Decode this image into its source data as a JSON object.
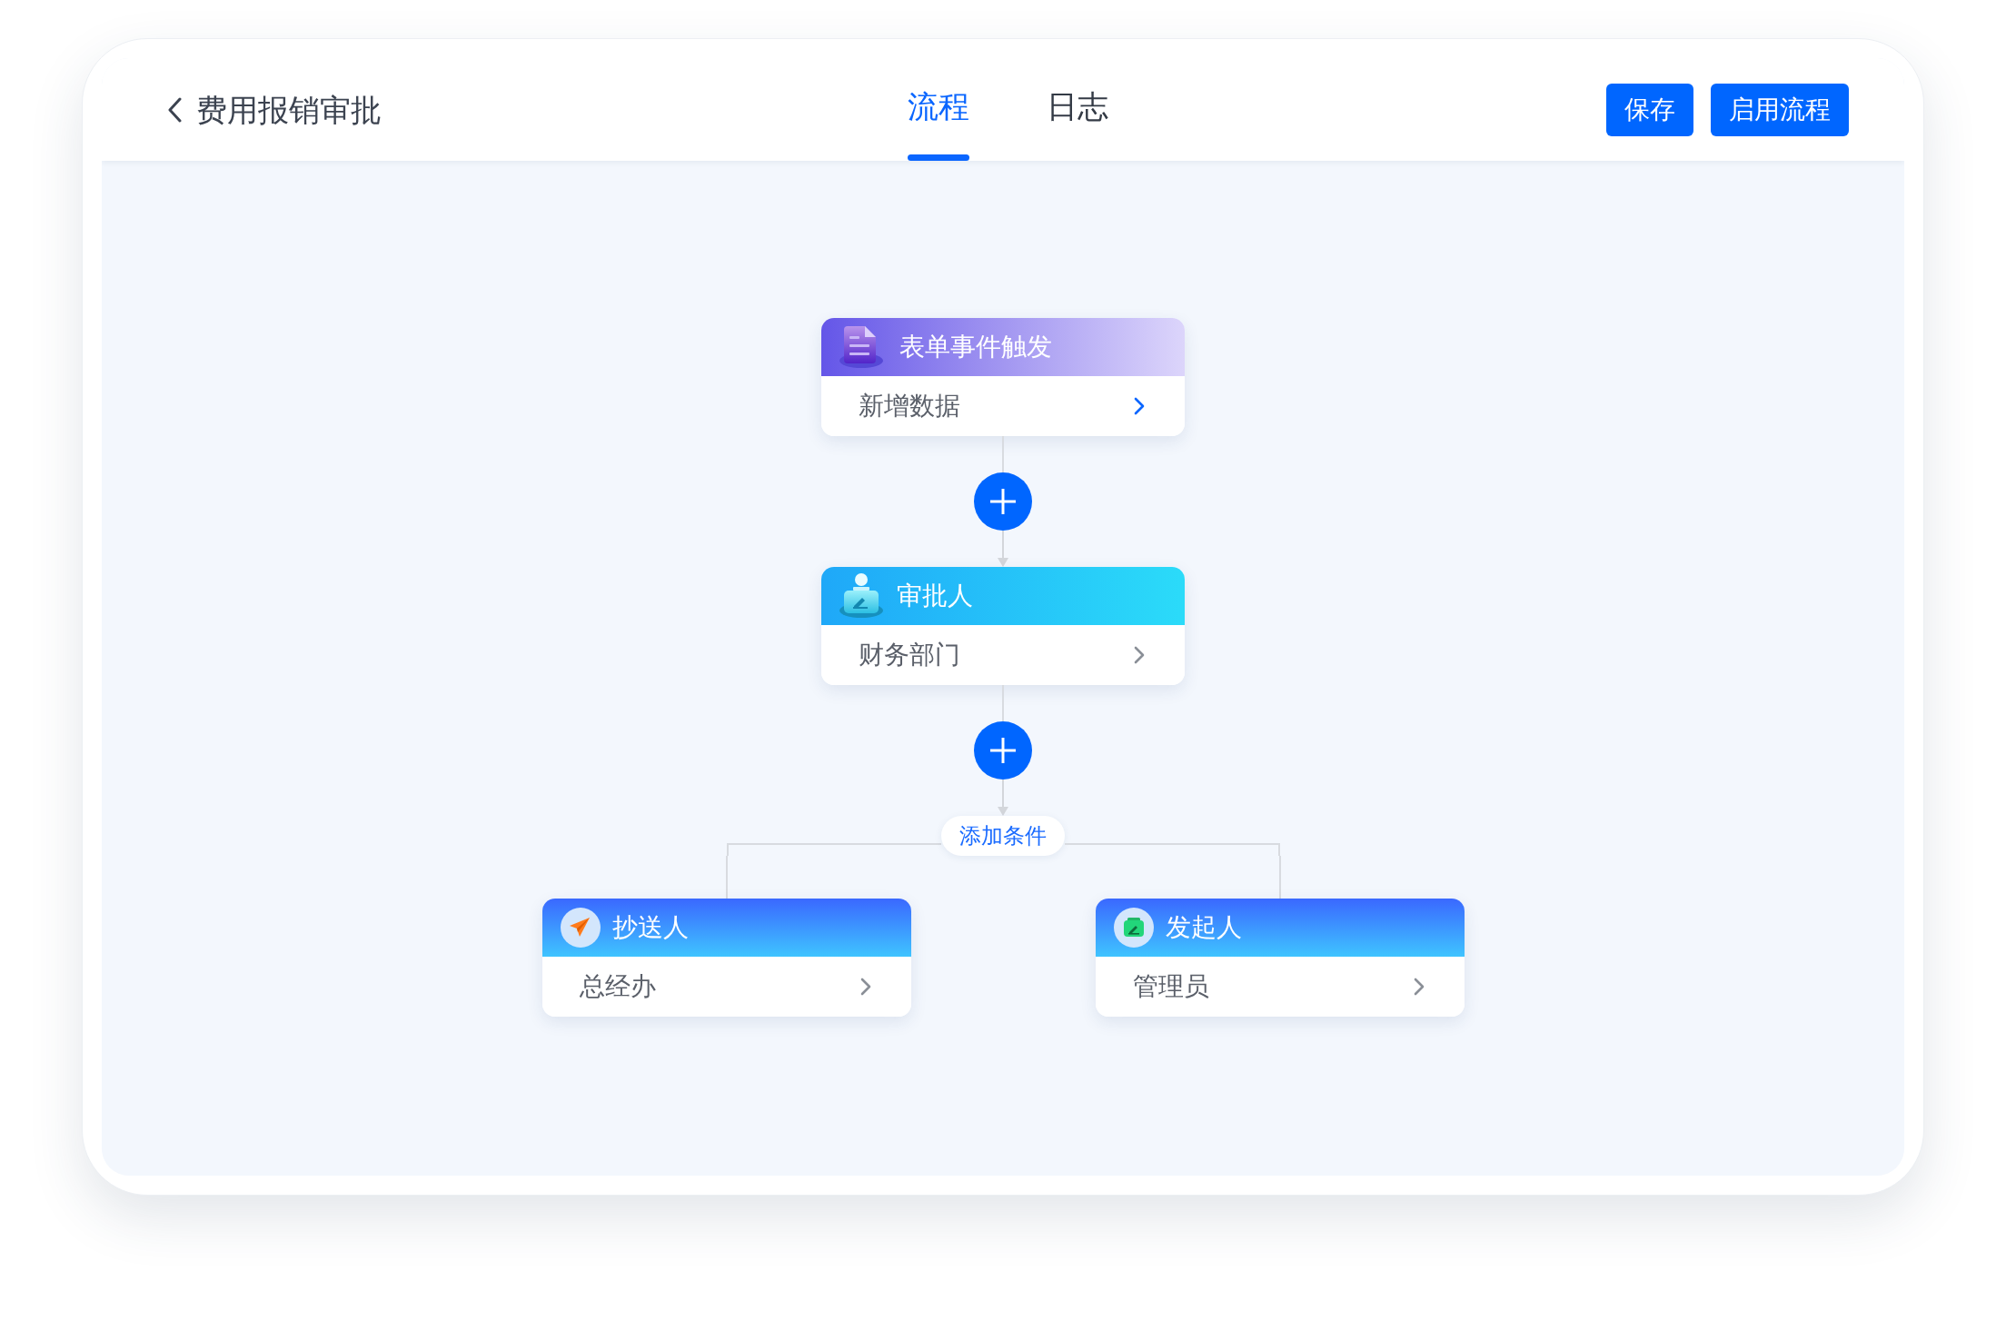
{
  "header": {
    "title": "费用报销审批",
    "tabs": [
      {
        "label": "流程",
        "selected": true
      },
      {
        "label": "日志",
        "selected": false
      }
    ],
    "buttons": [
      {
        "label": "保存"
      },
      {
        "label": "启用流程"
      }
    ]
  },
  "flow": {
    "nodes": [
      {
        "kind": "trigger",
        "title": "表单事件触发",
        "value": "新增数据",
        "selected": true
      },
      {
        "kind": "approver",
        "title": "审批人",
        "value": "财务部门",
        "selected": false
      }
    ],
    "condition_button": {
      "label": "添加条件"
    },
    "branches": [
      {
        "kind": "cc",
        "title": "抄送人",
        "value": "总经办",
        "selected": false
      },
      {
        "kind": "initiator",
        "title": "发起人",
        "value": "管理员",
        "selected": false
      }
    ]
  }
}
